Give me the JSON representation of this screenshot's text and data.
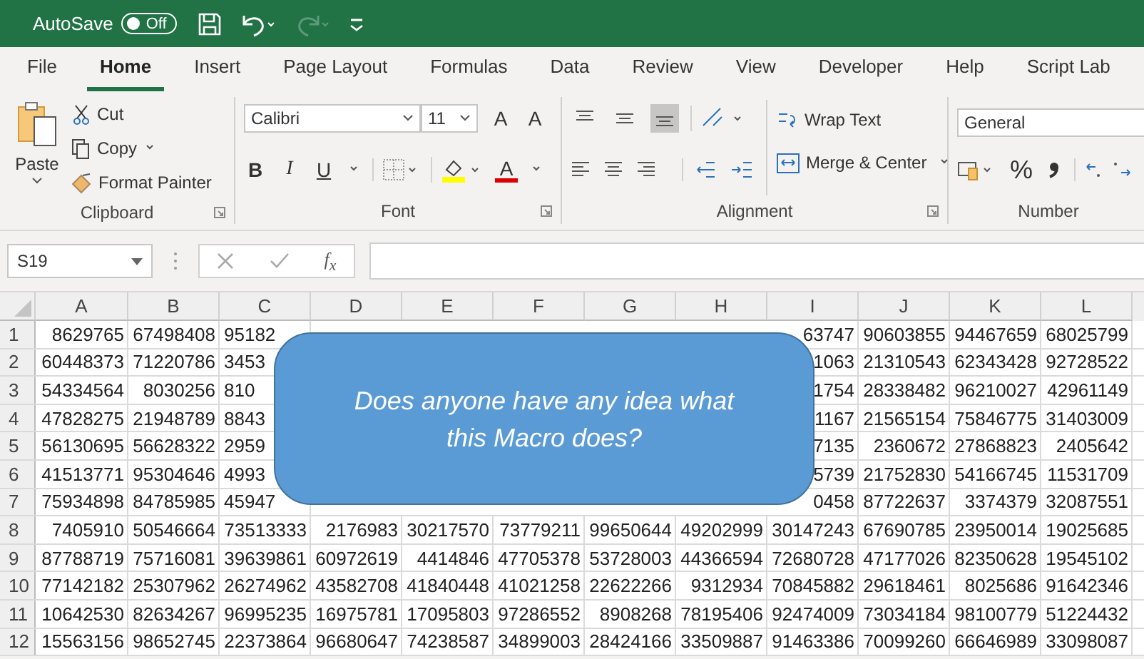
{
  "title_bar": {
    "autosave_label": "AutoSave",
    "autosave_toggle": {
      "label": "Off",
      "on": false
    }
  },
  "ribbon_tabs": [
    {
      "label": "File",
      "selected": false
    },
    {
      "label": "Home",
      "selected": true
    },
    {
      "label": "Insert",
      "selected": false
    },
    {
      "label": "Page Layout",
      "selected": false
    },
    {
      "label": "Formulas",
      "selected": false
    },
    {
      "label": "Data",
      "selected": false
    },
    {
      "label": "Review",
      "selected": false
    },
    {
      "label": "View",
      "selected": false
    },
    {
      "label": "Developer",
      "selected": false
    },
    {
      "label": "Help",
      "selected": false
    },
    {
      "label": "Script Lab",
      "selected": false
    }
  ],
  "ribbon": {
    "clipboard": {
      "paste": "Paste",
      "cut": "Cut",
      "copy": "Copy",
      "format_painter": "Format Painter",
      "group_label": "Clipboard"
    },
    "font": {
      "font_name": "Calibri",
      "font_size": "11",
      "grow": "A",
      "shrink": "A",
      "bold": "B",
      "italic": "I",
      "underline": "U",
      "font_color": "A",
      "group_label": "Font"
    },
    "alignment": {
      "vertical_align": [
        {
          "selected": false
        },
        {
          "selected": false
        },
        {
          "selected": true
        }
      ],
      "wrap_text": "Wrap Text",
      "merge_center": "Merge & Center",
      "group_label": "Alignment"
    },
    "number": {
      "format": "General",
      "percent": "%",
      "group_label": "Number"
    }
  },
  "formula_bar": {
    "name_box": "S19",
    "function_label": "f$_{x}$"
  },
  "sheet": {
    "columns": [
      "A",
      "B",
      "C",
      "D",
      "E",
      "F",
      "G",
      "H",
      "I",
      "J",
      "K",
      "L"
    ],
    "rows": [
      {
        "header": "1",
        "cells": [
          "8629765",
          "67498408",
          {
            "text": "95182",
            "kind": "cut"
          },
          null,
          null,
          null,
          null,
          null,
          "63747",
          "90603855",
          "94467659",
          "68025799"
        ]
      },
      {
        "header": "2",
        "cells": [
          "60448373",
          "71220786",
          {
            "text": "3453",
            "kind": "cut"
          },
          null,
          null,
          null,
          null,
          null,
          "1063",
          "21310543",
          "62343428",
          "92728522"
        ]
      },
      {
        "header": "3",
        "cells": [
          "54334564",
          "8030256",
          {
            "text": "810",
            "kind": "cut"
          },
          null,
          null,
          null,
          null,
          null,
          "1754",
          "28338482",
          "96210027",
          "42961149"
        ]
      },
      {
        "header": "4",
        "cells": [
          "47828275",
          "21948789",
          {
            "text": "8843",
            "kind": "cut"
          },
          null,
          null,
          null,
          null,
          null,
          "1167",
          "21565154",
          "75846775",
          "31403009"
        ]
      },
      {
        "header": "5",
        "cells": [
          "56130695",
          "56628322",
          {
            "text": "2959",
            "kind": "cut"
          },
          null,
          null,
          null,
          null,
          null,
          "7135",
          "2360672",
          "27868823",
          "2405642"
        ]
      },
      {
        "header": "6",
        "cells": [
          "41513771",
          "95304646",
          {
            "text": "4993",
            "kind": "cut"
          },
          null,
          null,
          null,
          null,
          null,
          "5739",
          "21752830",
          "54166745",
          "11531709"
        ]
      },
      {
        "header": "7",
        "cells": [
          "75934898",
          "84785985",
          {
            "text": "45947",
            "kind": "cut"
          },
          null,
          null,
          null,
          null,
          null,
          "0458",
          "87722637",
          "3374379",
          "32087551"
        ]
      },
      {
        "header": "8",
        "cells": [
          "7405910",
          "50546664",
          "73513333",
          "2176983",
          "30217570",
          "73779211",
          "99650644",
          "49202999",
          "30147243",
          "67690785",
          "23950014",
          "19025685"
        ]
      },
      {
        "header": "9",
        "cells": [
          "87788719",
          "75716081",
          "39639861",
          "60972619",
          "4414846",
          "47705378",
          "53728003",
          "44366594",
          "72680728",
          "47177026",
          "82350628",
          "19545102"
        ]
      },
      {
        "header": "10",
        "cells": [
          "77142182",
          "25307962",
          "26274962",
          "43582708",
          "41840448",
          "41021258",
          "22622266",
          "9312934",
          "70845882",
          "29618461",
          "8025686",
          "91642346"
        ]
      },
      {
        "header": "11",
        "cells": [
          "10642530",
          "82634267",
          "96995235",
          "16975781",
          "17095803",
          "97286552",
          "8908268",
          "78195406",
          "92474009",
          "73034184",
          "98100779",
          "51224432"
        ]
      },
      {
        "header": "12",
        "cells": [
          "15563156",
          "98652745",
          "22373864",
          "96680647",
          "74238587",
          "34899003",
          "28424166",
          "33509887",
          "91463386",
          "70099260",
          "66646989",
          "33098087"
        ]
      }
    ]
  },
  "callout": {
    "text": "Does anyone have any idea what this Macro does?"
  }
}
